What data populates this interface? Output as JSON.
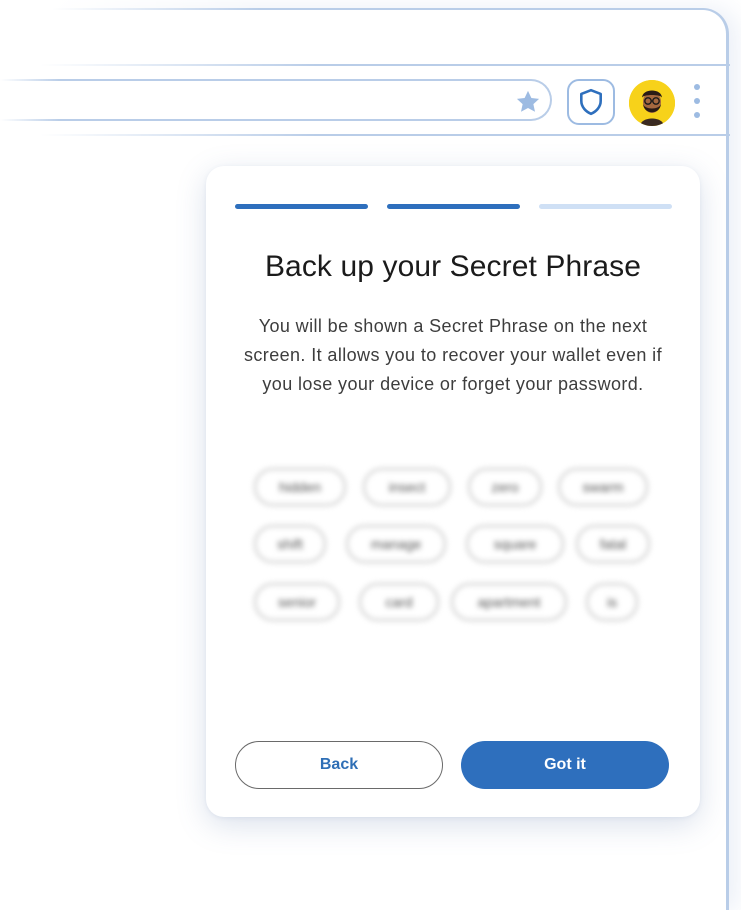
{
  "browser": {
    "toolbar_icons": [
      "star-icon",
      "shield-icon",
      "avatar",
      "more-vert-icon"
    ],
    "colors": {
      "frame": "#b9cde8",
      "accent": "#2e6fbd"
    }
  },
  "onboarding": {
    "progress": {
      "total_steps": 3,
      "completed_steps": 2,
      "colors": {
        "done": "#2e6fbd",
        "pending": "#cfe0f5"
      }
    },
    "title": "Back up your Secret Phrase",
    "description": "You will be shown a Secret Phrase on the next screen. It allows you to recover your wallet even if you lose your device or forget your password.",
    "phrase_words": [
      "hidden",
      "insect",
      "zero",
      "swarm",
      "shift",
      "manage",
      "square",
      "fatal",
      "senior",
      "card",
      "apartment",
      "is"
    ],
    "back_label": "Back",
    "confirm_label": "Got it"
  }
}
